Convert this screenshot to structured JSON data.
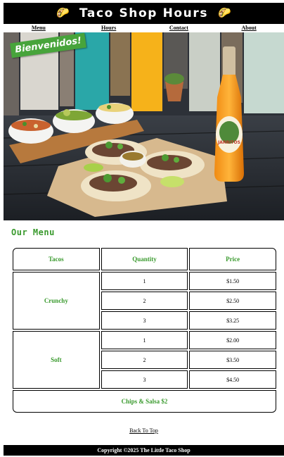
{
  "header": {
    "title": "Taco Shop Hours",
    "left_icon": "taco-icon",
    "right_icon": "taco-icon"
  },
  "nav": {
    "items": [
      {
        "label": "Menu"
      },
      {
        "label": "Hours"
      },
      {
        "label": "Contact"
      },
      {
        "label": "About"
      }
    ]
  },
  "hero": {
    "banner": "Bienvenidos!",
    "bottle_label": "JARRITOS"
  },
  "menu": {
    "title": "Our Menu",
    "columns": [
      "Tacos",
      "Quantity",
      "Price"
    ],
    "groups": [
      {
        "name": "Crunchy",
        "rows": [
          {
            "quantity": "1",
            "price": "$1.50"
          },
          {
            "quantity": "2",
            "price": "$2.50"
          },
          {
            "quantity": "3",
            "price": "$3.25"
          }
        ]
      },
      {
        "name": "Soft",
        "rows": [
          {
            "quantity": "1",
            "price": "$2.00"
          },
          {
            "quantity": "2",
            "price": "$3.50"
          },
          {
            "quantity": "3",
            "price": "$4.50"
          }
        ]
      }
    ],
    "extra": "Chips & Salsa $2"
  },
  "back_to_top": "Back To Top",
  "footer": {
    "copyright": "Copyright ©2025 The Little Taco Shop"
  },
  "colors": {
    "accent_green": "#3a9a2e",
    "header_bg": "#000000",
    "banner_green": "#47a43b"
  }
}
